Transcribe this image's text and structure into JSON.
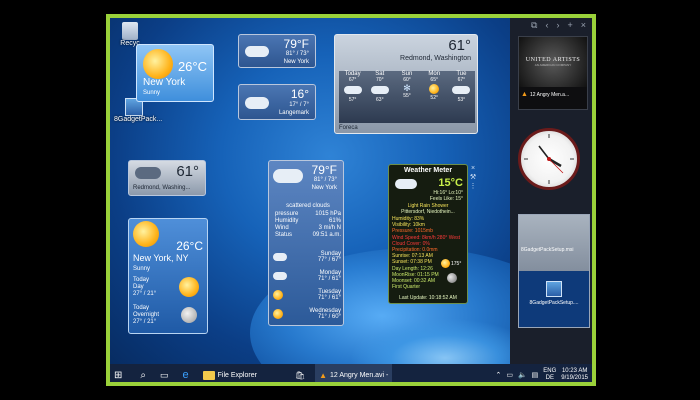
{
  "sidebar_toolbar": {
    "pin": "⧉",
    "prev": "‹",
    "next": "›",
    "add": "+",
    "close": "×"
  },
  "desktop_icons": {
    "recycle_label": "Recyc",
    "gadget_label": "8GadgetPack..."
  },
  "widget_ny_top": {
    "temp": "26°C",
    "city": "New York",
    "condition": "Sunny"
  },
  "widget_ny_small": {
    "temp": "79°F",
    "range": "81° / 73°",
    "city": "New York"
  },
  "widget_langemark": {
    "temp": "16°",
    "range": "17° / 7°",
    "city": "Langemark"
  },
  "widget_redmond": {
    "temp": "61°",
    "city": "Redmond, Washington",
    "days": [
      {
        "name": "Today",
        "hi": "67°",
        "lo": "57°"
      },
      {
        "name": "Sat",
        "hi": "70°",
        "lo": "63°"
      },
      {
        "name": "Sun",
        "hi": "60°",
        "lo": "55°"
      },
      {
        "name": "Mon",
        "hi": "65°",
        "lo": "52°"
      },
      {
        "name": "Tue",
        "hi": "67°",
        "lo": "53°"
      }
    ],
    "provider": "Foreca"
  },
  "widget_small_redmond": {
    "temp": "61°",
    "city": "Redmond, Washing..."
  },
  "widget_ny_detail": {
    "temp": "79°F",
    "range": "81° / 73°",
    "city": "New York",
    "description": "scattered clouds",
    "pressure": "1015 hPa",
    "humidity": "61%",
    "wind": "3 mi/h N",
    "status": "09:51 a.m.",
    "labels": {
      "pressure": "pressure",
      "humidity": "Humidity",
      "wind": "Wind",
      "status": "Status"
    },
    "forecast": [
      {
        "day": "Sunday",
        "range": "77° / 67°"
      },
      {
        "day": "Monday",
        "range": "71° / 61°"
      },
      {
        "day": "Tuesday",
        "range": "71° / 61°"
      },
      {
        "day": "Wednesday",
        "range": "71° / 60°"
      }
    ]
  },
  "widget_ny_big": {
    "temp": "26°C",
    "city": "New York, NY",
    "condition": "Sunny",
    "today_day": {
      "label": "Today",
      "sub": "Day",
      "range": "27° / 21°"
    },
    "today_night": {
      "label": "Today",
      "sub": "Overnight",
      "range": "27° / 21°"
    }
  },
  "weather_meter": {
    "title": "Weather Meter",
    "temp": "15°C",
    "hi_lo": "Hi:16° Lo:10°",
    "feels": "Feels Like: 15°",
    "condition": "Light Rain Shower",
    "location": "Pittersdorf, Niedothein...",
    "rows": [
      "Humidity: 83%",
      "Visibility: 10km",
      "Pressure: 1015mb",
      "Wind Speed: 8km/h 280° West",
      "Cloud Cover: 0%",
      "Precipitation: 0.0mm",
      "Sunrise: 07:13 AM",
      "Sunset: 07:38 PM",
      "Day Length: 12:26",
      "MoonRise: 01:15 PM",
      "Moonset: 00:32 AM",
      "First Quarter"
    ],
    "sun_angle": "175°",
    "last_update": "Last Update: 10:18:52 AM"
  },
  "sidebar_items": {
    "media_title": "UNITED ARTISTS",
    "media_sub": "AN AMERICAN COMPANY",
    "media_file": "12 Angry Men.a...",
    "setup_top": "8GadgetPackSetup.msi",
    "setup_bottom": "8GadgetPackSetup...."
  },
  "taskbar": {
    "start": "⊞",
    "search": "⌕",
    "taskview": "▭",
    "edge": "e",
    "explorer_label": "File Explorer",
    "store": "🛍",
    "vlc_label": "12 Angry Men.avi -",
    "lang": "ENG",
    "lang_sub": "DE",
    "time": "10:23 AM",
    "date": "9/19/2015"
  },
  "colors": {
    "frame": "#9ad13a",
    "taskbar": "#14233f",
    "meter_text": "#c9e86a"
  }
}
